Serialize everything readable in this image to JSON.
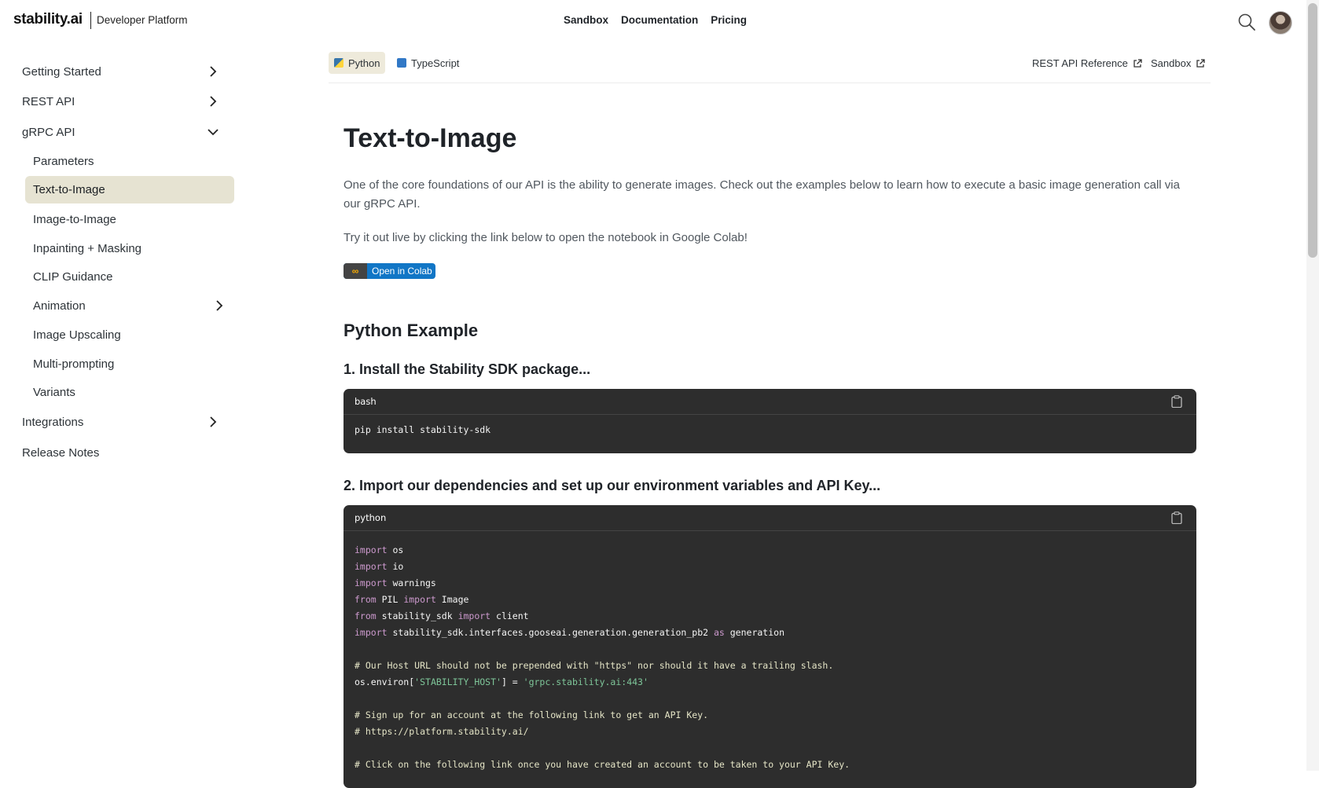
{
  "header": {
    "logo": "stability.ai",
    "sub_title": "Developer Platform",
    "nav": [
      "Sandbox",
      "Documentation",
      "Pricing"
    ]
  },
  "sidebar": {
    "items": [
      {
        "label": "Getting Started",
        "chevron": "right"
      },
      {
        "label": "REST API",
        "chevron": "right"
      },
      {
        "label": "gRPC API",
        "chevron": "down"
      },
      {
        "label": "Parameters"
      },
      {
        "label": "Text-to-Image",
        "active": true
      },
      {
        "label": "Image-to-Image"
      },
      {
        "label": "Inpainting + Masking"
      },
      {
        "label": "CLIP Guidance"
      },
      {
        "label": "Animation",
        "chevron": "right"
      },
      {
        "label": "Image Upscaling"
      },
      {
        "label": "Multi-prompting"
      },
      {
        "label": "Variants"
      },
      {
        "label": "Integrations",
        "chevron": "right"
      },
      {
        "label": "Release Notes"
      }
    ]
  },
  "tabs": {
    "python": "Python",
    "typescript": "TypeScript",
    "rest_ref": "REST API Reference",
    "sandbox": "Sandbox"
  },
  "main": {
    "title": "Text-to-Image",
    "intro": "One of the core foundations of our API is the ability to generate images. Check out the examples below to learn how to execute a basic image generation call via our gRPC API.",
    "try_it": "Try it out live by clicking the link below to open the notebook in Google Colab!",
    "colab_label": "Open in Colab",
    "section": "Python Example",
    "step1": "1. Install the Stability SDK package...",
    "step2": "2. Import our dependencies and set up our environment variables and API Key..."
  },
  "code1": {
    "lang": "bash",
    "lines": [
      "pip install stability-sdk"
    ]
  },
  "code2": {
    "lang": "python",
    "lines": [
      "import os",
      "import io",
      "import warnings",
      "from PIL import Image",
      "from stability_sdk import client",
      "import stability_sdk.interfaces.gooseai.generation.generation_pb2 as generation",
      "",
      "# Our Host URL should not be prepended with \"https\" nor should it have a trailing slash.",
      "os.environ['STABILITY_HOST'] = 'grpc.stability.ai:443'",
      "",
      "# Sign up for an account at the following link to get an API Key.",
      "# https://platform.stability.ai/",
      "",
      "# Click on the following link once you have created an account to be taken to your API Key."
    ]
  },
  "colors": {
    "active_bg": "#e6e3d2",
    "code_bg": "#2d2d2d",
    "colab_blue": "#1176c6"
  }
}
